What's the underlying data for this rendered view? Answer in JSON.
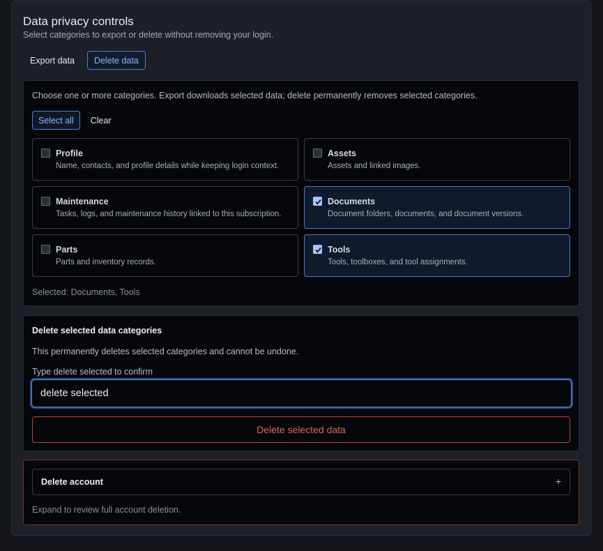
{
  "header": {
    "title": "Data privacy controls",
    "subtitle": "Select categories to export or delete without removing your login."
  },
  "tabs": [
    {
      "label": "Export data",
      "active": false
    },
    {
      "label": "Delete data",
      "active": true
    }
  ],
  "categories_panel": {
    "hint": "Choose one or more categories. Export downloads selected data; delete permanently removes selected categories.",
    "select_all_label": "Select all",
    "clear_label": "Clear",
    "items": [
      {
        "name": "Profile",
        "description": "Name, contacts, and profile details while keeping login context.",
        "checked": false
      },
      {
        "name": "Assets",
        "description": "Assets and linked images.",
        "checked": false
      },
      {
        "name": "Maintenance",
        "description": "Tasks, logs, and maintenance history linked to this subscription.",
        "checked": false
      },
      {
        "name": "Documents",
        "description": "Document folders, documents, and document versions.",
        "checked": true
      },
      {
        "name": "Parts",
        "description": "Parts and inventory records.",
        "checked": false
      },
      {
        "name": "Tools",
        "description": "Tools, toolboxes, and tool assignments.",
        "checked": true
      }
    ],
    "selected_text": "Selected: Documents, Tools"
  },
  "delete_panel": {
    "title": "Delete selected data categories",
    "warning": "This permanently deletes selected categories and cannot be undone.",
    "confirm_label": "Type delete selected to confirm",
    "confirm_value": "delete selected",
    "button_label": "Delete selected data"
  },
  "account_panel": {
    "header_label": "Delete account",
    "expand_symbol": "+",
    "note": "Expand to review full account deletion."
  },
  "colors": {
    "accent": "#4f7fd6",
    "danger": "#e2685a",
    "background": "#15171c"
  }
}
